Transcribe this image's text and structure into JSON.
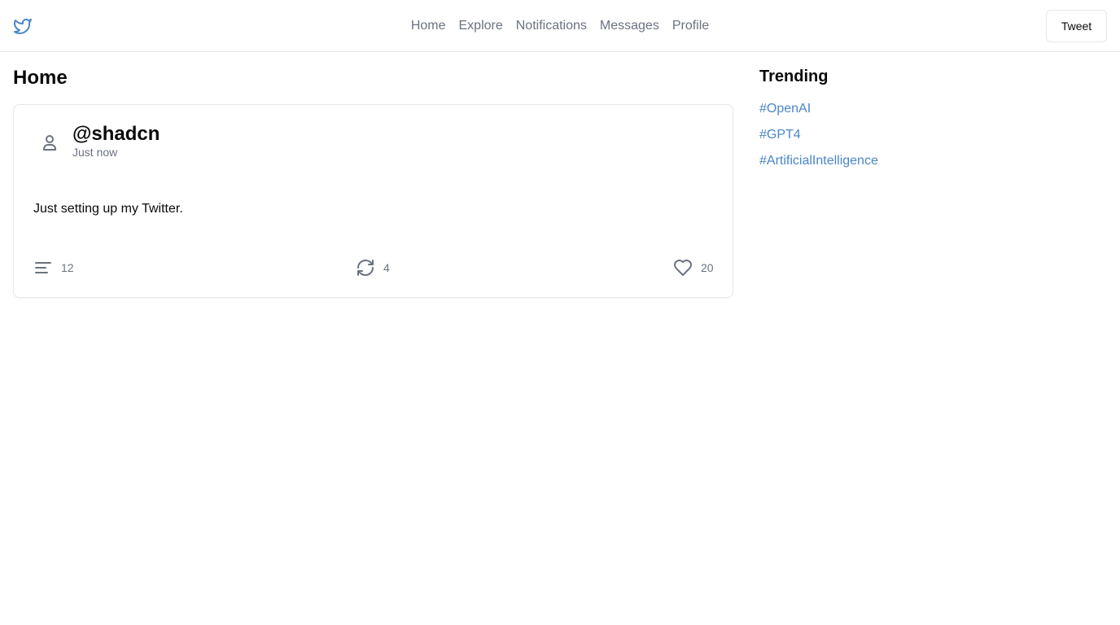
{
  "header": {
    "logo_icon": "twitter-bird-icon",
    "brand_color": "#4a86c8",
    "nav": [
      {
        "label": "Home"
      },
      {
        "label": "Explore"
      },
      {
        "label": "Notifications"
      },
      {
        "label": "Messages"
      },
      {
        "label": "Profile"
      }
    ],
    "tweet_button_label": "Tweet"
  },
  "main": {
    "title": "Home",
    "post": {
      "avatar_icon": "user-icon",
      "handle": "@shadcn",
      "timestamp": "Just now",
      "text": "Just setting up my Twitter.",
      "actions": {
        "replies": {
          "icon": "reply-lines-icon",
          "count": "12"
        },
        "retweets": {
          "icon": "retweet-icon",
          "count": "4"
        },
        "likes": {
          "icon": "heart-icon",
          "count": "20"
        }
      }
    }
  },
  "sidebar": {
    "title": "Trending",
    "topics": [
      "#OpenAI",
      "#GPT4",
      "#ArtificialIntelligence"
    ],
    "link_color": "#4a86c8"
  }
}
